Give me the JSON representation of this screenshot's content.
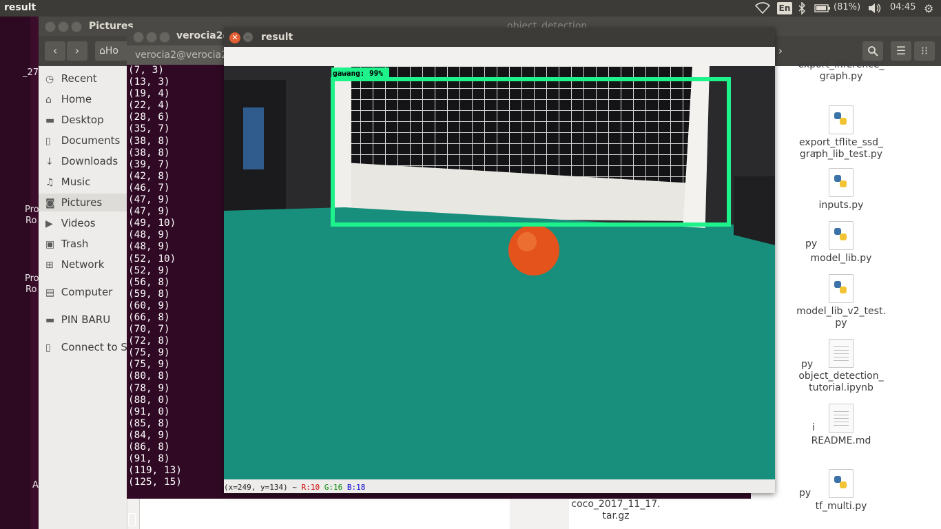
{
  "top_panel": {
    "app_title": "result",
    "keyboard": "En",
    "battery": "(81%)",
    "clock": "04:45"
  },
  "desktop_labels": [
    "_27",
    "Pro",
    "Ro",
    "Pro",
    "Ro",
    "A"
  ],
  "nautilus": {
    "title": "Pictures",
    "title_behind": "object_detection",
    "home_crumb": "Ho",
    "sidebar": [
      {
        "label": "Recent",
        "icon": "clock-icon"
      },
      {
        "label": "Home",
        "icon": "home-icon"
      },
      {
        "label": "Desktop",
        "icon": "folder-icon"
      },
      {
        "label": "Documents",
        "icon": "document-icon"
      },
      {
        "label": "Downloads",
        "icon": "download-icon"
      },
      {
        "label": "Music",
        "icon": "music-icon"
      },
      {
        "label": "Pictures",
        "icon": "camera-icon"
      },
      {
        "label": "Videos",
        "icon": "video-icon"
      },
      {
        "label": "Trash",
        "icon": "trash-icon"
      },
      {
        "label": "Network",
        "icon": "network-icon"
      },
      {
        "label": "Computer",
        "icon": "drive-icon"
      },
      {
        "label": "PIN BARU",
        "icon": "folder-icon"
      },
      {
        "label": "Connect to S...",
        "icon": "server-icon"
      }
    ],
    "files": [
      {
        "name": "export_inference_\ngraph.py",
        "type": "py"
      },
      {
        "name": "export_tflite_ssd_\ngraph_lib_test.py",
        "type": "py"
      },
      {
        "name": "inputs.py",
        "type": "py"
      },
      {
        "name": "model_lib.py",
        "type": "py"
      },
      {
        "name": "model_lib_v2_test.\npy",
        "type": "py"
      },
      {
        "name": "object_detection_\ntutorial.ipynb",
        "type": "txt"
      },
      {
        "name": "README.md",
        "type": "txt"
      },
      {
        "name": "tf_multi.py",
        "type": "py"
      }
    ],
    "behind_file": "coco_2017_11_17.\ntar.gz",
    "partial_labels": [
      "py",
      "py",
      "i",
      "py",
      "_"
    ]
  },
  "terminal": {
    "title": "verocia2@",
    "subtitle": "verocia2@verocia2",
    "lines": [
      "(7, 3)",
      "(13, 3)",
      "(19, 4)",
      "(22, 4)",
      "(28, 6)",
      "(35, 7)",
      "(38, 8)",
      "(38, 8)",
      "(39, 7)",
      "(42, 8)",
      "(46, 7)",
      "(47, 9)",
      "(47, 9)",
      "(49, 10)",
      "(48, 9)",
      "(48, 9)",
      "(52, 10)",
      "(52, 9)",
      "(56, 8)",
      "(59, 8)",
      "(60, 9)",
      "(66, 8)",
      "(70, 7)",
      "(72, 8)",
      "(75, 9)",
      "(75, 9)",
      "(80, 8)",
      "(78, 9)",
      "(88, 0)",
      "(91, 0)",
      "(85, 8)",
      "(84, 9)",
      "(86, 8)",
      "(91, 8)",
      "(119, 13)",
      "(125, 15)"
    ]
  },
  "result_window": {
    "title": "result",
    "detection_label": "gawang:  99%",
    "detection_color": "#1ef28a",
    "status": {
      "coords": "(x=249, y=134) ~",
      "r": "R:10",
      "g": "G:16",
      "b": "B:18"
    }
  }
}
